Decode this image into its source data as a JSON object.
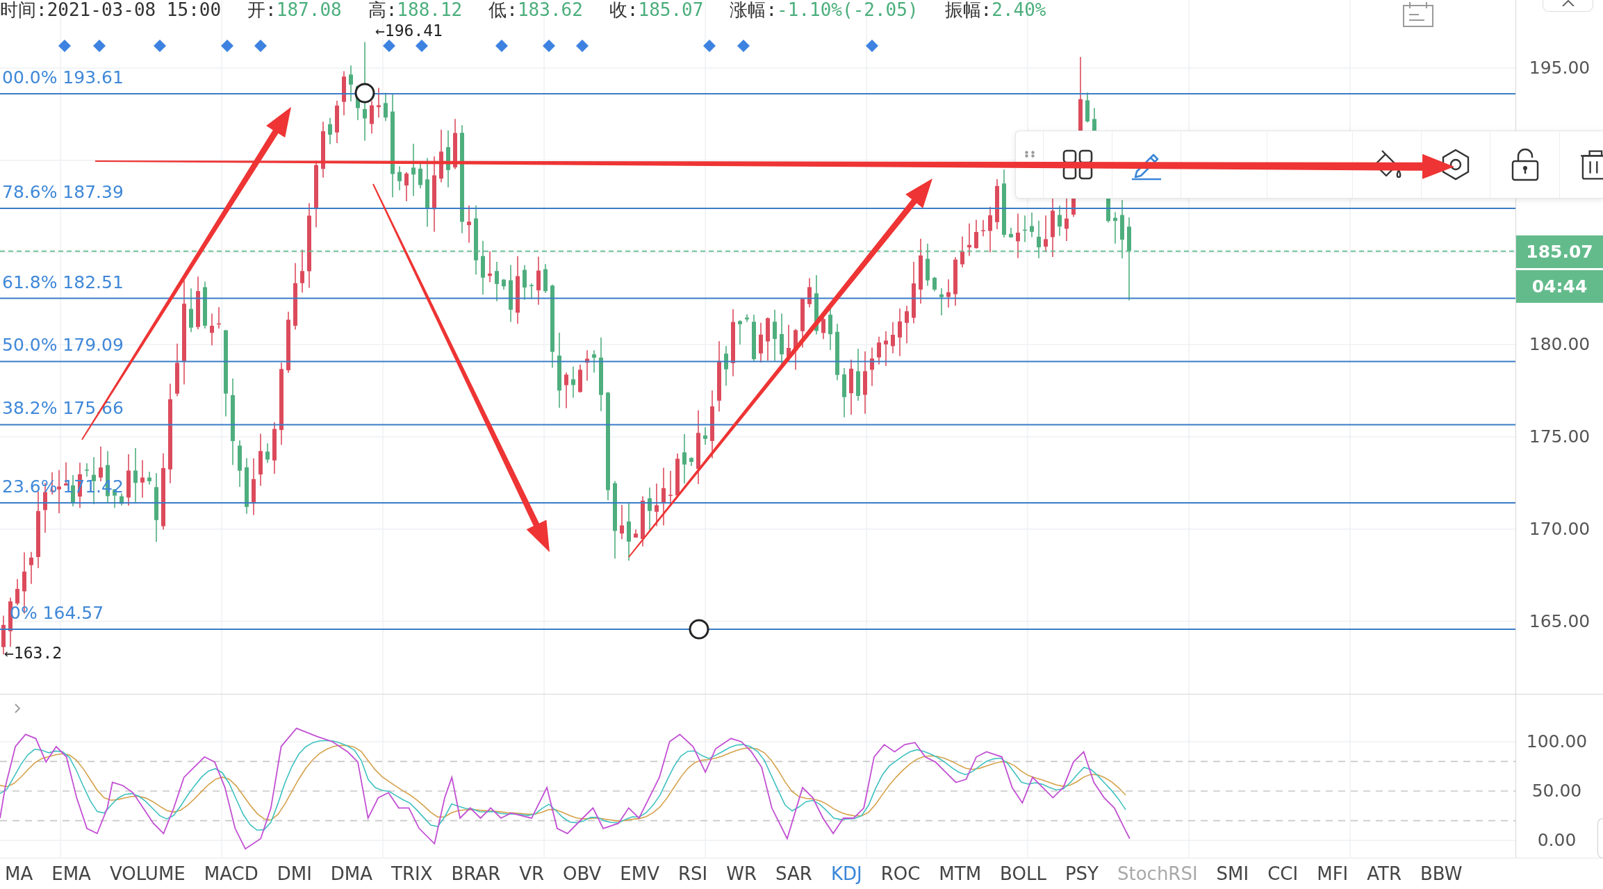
{
  "info_bar": [
    {
      "kind": "time",
      "label": "时间:",
      "value": "2021-03-08 15:00"
    },
    {
      "kind": "quote",
      "label": "开:",
      "value": "187.08"
    },
    {
      "kind": "quote",
      "label": "高:",
      "value": "188.12"
    },
    {
      "kind": "quote",
      "label": "低:",
      "value": "183.62"
    },
    {
      "kind": "quote",
      "label": "收:",
      "value": "185.07"
    },
    {
      "kind": "quote",
      "label": "涨幅:",
      "value": "-1.10%(-2.05)"
    },
    {
      "kind": "quote",
      "label": "振幅:",
      "value": "2.40%"
    }
  ],
  "price_chart": {
    "high_marker": "←196.41",
    "low_marker": "←163.2",
    "fib_levels": [
      {
        "label": "00.0% 193.61"
      },
      {
        "label": "78.6% 187.39"
      },
      {
        "label": "61.8% 182.51"
      },
      {
        "label": "50.0% 179.09"
      },
      {
        "label": "38.2% 175.66"
      },
      {
        "label": "23.6% 171.42"
      },
      {
        "label": "0% 164.57"
      }
    ]
  },
  "price_axis": {
    "labels": [
      "195.00",
      "180.00",
      "175.00",
      "170.00",
      "165.00"
    ],
    "last_price": "185.07",
    "countdown": "04:44"
  },
  "indicator_panel": {
    "axis_labels": [
      "100.00",
      "50.00",
      "0.00"
    ]
  },
  "indicator_tabs": [
    {
      "label": "MA",
      "selected": false,
      "disabled": false
    },
    {
      "label": "EMA",
      "selected": false,
      "disabled": false
    },
    {
      "label": "VOLUME",
      "selected": false,
      "disabled": false
    },
    {
      "label": "MACD",
      "selected": false,
      "disabled": false
    },
    {
      "label": "DMI",
      "selected": false,
      "disabled": false
    },
    {
      "label": "DMA",
      "selected": false,
      "disabled": false
    },
    {
      "label": "TRIX",
      "selected": false,
      "disabled": false
    },
    {
      "label": "BRAR",
      "selected": false,
      "disabled": false
    },
    {
      "label": "VR",
      "selected": false,
      "disabled": false
    },
    {
      "label": "OBV",
      "selected": false,
      "disabled": false
    },
    {
      "label": "EMV",
      "selected": false,
      "disabled": false
    },
    {
      "label": "RSI",
      "selected": false,
      "disabled": false
    },
    {
      "label": "WR",
      "selected": false,
      "disabled": false
    },
    {
      "label": "SAR",
      "selected": false,
      "disabled": false
    },
    {
      "label": "KDJ",
      "selected": true,
      "disabled": false
    },
    {
      "label": "ROC",
      "selected": false,
      "disabled": false
    },
    {
      "label": "MTM",
      "selected": false,
      "disabled": false
    },
    {
      "label": "BOLL",
      "selected": false,
      "disabled": false
    },
    {
      "label": "PSY",
      "selected": false,
      "disabled": false
    },
    {
      "label": "StochRSI",
      "selected": false,
      "disabled": true
    },
    {
      "label": "SMI",
      "selected": false,
      "disabled": false
    },
    {
      "label": "CCI",
      "selected": false,
      "disabled": false
    },
    {
      "label": "MFI",
      "selected": false,
      "disabled": false
    },
    {
      "label": "ATR",
      "selected": false,
      "disabled": false
    },
    {
      "label": "BBW",
      "selected": false,
      "disabled": false
    }
  ]
}
